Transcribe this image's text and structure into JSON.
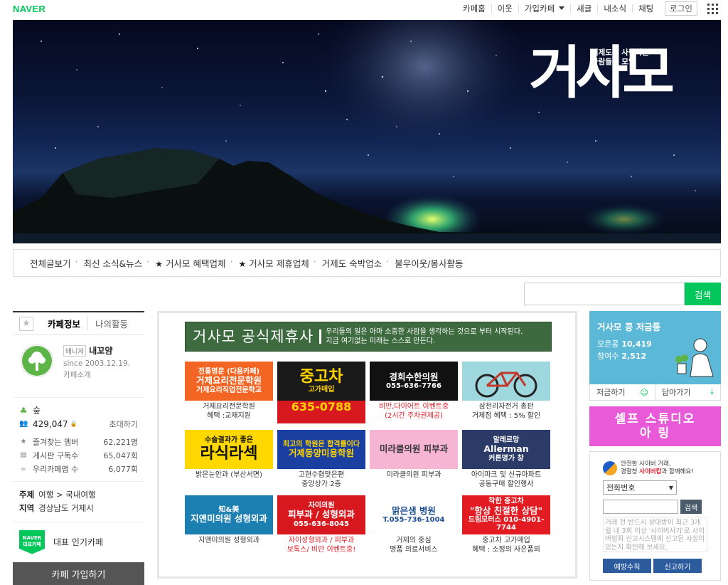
{
  "gnb": {
    "logo": "NAVER",
    "items": [
      "카페홈",
      "이웃",
      "가입카페",
      "새글",
      "내소식",
      "채팅"
    ],
    "login": "로그인"
  },
  "banner": {
    "title": "거사모",
    "subtitle_line1": "거제도를 사랑하는",
    "subtitle_line2": "사람들의 모임"
  },
  "menu": [
    {
      "label": "전체글보기",
      "star": false
    },
    {
      "label": "최신 소식&뉴스",
      "star": false
    },
    {
      "label": "거사모 혜택업체",
      "star": true
    },
    {
      "label": "거사모 제휴업체",
      "star": true
    },
    {
      "label": "거제도 숙박업소",
      "star": false
    },
    {
      "label": "불우이웃/봉사활동",
      "star": false
    }
  ],
  "search": {
    "button": "검색"
  },
  "left": {
    "tab_info": "카페정보",
    "tab_my": "나의활동",
    "manager_badge": "매니저",
    "manager_name": "내꼬얌",
    "since": "since 2003.12.19.",
    "intro": "카페소개",
    "level": "숲",
    "members": "429,047",
    "invite": "초대하기",
    "stats": [
      {
        "label": "즐겨찾는 멤버",
        "value": "62,221명"
      },
      {
        "label": "게시판 구독수",
        "value": "65,047회"
      },
      {
        "label": "우리카페앱 수",
        "value": "6,077회"
      }
    ],
    "topic_key": "주제",
    "topic_val": "여행 > 국내여행",
    "region_key": "지역",
    "region_val": "경상남도 거제시",
    "badge_line1": "NAVER",
    "badge_line2": "대표카페",
    "badge_text": "대표 인기카페",
    "join": "카페 가입하기"
  },
  "partners": {
    "title": "거사모 공식제휴사",
    "desc_line1": "우리들의 일은 아마 소중한 사람을 생각하는 것으로 부터 시작된다.",
    "desc_line2": "지금 여기없는 미래는 스스로 만든다.",
    "ads": [
      {
        "top1": "전통명문 (다음카페)",
        "top2": "거제요리전문학원",
        "top3": "거제요리직업전문학교",
        "bottom1": "거제요리전문학원",
        "bottom2": "혜택 :교재지원",
        "bg": "#f26522",
        "fg": "#ffffff"
      },
      {
        "top1": "",
        "top2": "중고차",
        "top3": "고가매입",
        "bottom1": "635-0788",
        "bottom2": "",
        "bg": "#1a1a1a",
        "fg": "#ffd400"
      },
      {
        "top1": "",
        "top2": "경희수한의원",
        "top3": "055-636-7766",
        "bottom1": "비만,다이어트 이벤트중",
        "bottom2": "(2시간 주차권제공)",
        "bg": "#111111",
        "fg": "#ffffff"
      },
      {
        "top1": "",
        "top2": "",
        "top3": "",
        "bottom1": "삼천리자전거 총판",
        "bottom2": "거제점 혜택 : 5% 할인",
        "bg": "#9fd7df",
        "fg": "#333333"
      },
      {
        "top1": "수술결과가 좋은",
        "top2": "라식라섹",
        "top3": "",
        "bottom1": "밝은눈안과 (부산서면)",
        "bottom2": "",
        "bg": "#ffd800",
        "fg": "#111111"
      },
      {
        "top1": "최고의 학원은 합격률이다",
        "top2": "거제동양미용학원",
        "top3": "",
        "bottom1": "고현수협맞은편",
        "bottom2": "중앙상가 2층",
        "bg": "#1b3fa0",
        "fg": "#ffd400"
      },
      {
        "top1": "",
        "top2": "미라클의원 피부과",
        "top3": "",
        "bottom1": "미라클의원 피부과",
        "bottom2": "",
        "bg": "#f6b5d3",
        "fg": "#333333"
      },
      {
        "top1": "알레르망",
        "top2": "Allerman",
        "top3": "커튼명가 창",
        "bottom1": "아이파크 및 신규아파트",
        "bottom2": "공동구매 할인행사",
        "bg": "#2b3a67",
        "fg": "#ffffff"
      },
      {
        "top1": "知&美",
        "top2": "지앤미의원 성형외과",
        "top3": "",
        "bottom1": "지앤미의원 성형외과",
        "bottom2": "",
        "bg": "#1c7fb1",
        "fg": "#ffffff"
      },
      {
        "top1": "자이의원",
        "top2": "피부과 / 성형외과",
        "top3": "055-636-8045",
        "bottom1": "자이성형외과 / 피부과",
        "bottom2": "보톡스/ 비만 이벤트중!",
        "bg": "#d7191f",
        "fg": "#ffffff"
      },
      {
        "top1": "",
        "top2": "맑은샘 병원",
        "top3": "T.055-736-1004",
        "bottom1": "거제의 중심",
        "bottom2": "명품 의료서비스",
        "bg": "#ffffff",
        "fg": "#1d4f91"
      },
      {
        "top1": "착한 중고차",
        "top2": "\"항상 친절한 상담\"",
        "top3": "드림모터스 010-4901-7744",
        "bottom1": "중고차 고가매입",
        "bottom2": "혜택 : 소정의 사은품외",
        "bg": "#e31b23",
        "fg": "#ffffff"
      }
    ]
  },
  "right": {
    "fund_title": "거사모 콩 저금통",
    "fund_label1": "모은콩",
    "fund_val1": "10,419",
    "fund_label2": "참여수",
    "fund_val2": "2,512",
    "fund_btn1": "저금하기",
    "fund_btn2": "담아가기",
    "studio_line1": "셀프 스튜디오",
    "studio_line2": "아 링",
    "cyber_head1": "안전한 사이버 거래,",
    "cyber_head2a": "경찰청 ",
    "cyber_head2b": "사이버캅",
    "cyber_head2c": "과 함께해요!",
    "cyber_select": "전화번호",
    "cyber_btn": "검색",
    "cyber_note": "거래 전 반드시 상대방이 최근 3개월 내 3회 이상 '사이버사기'로 사이버범죄 신고시스템에 신고된 사실이 있는지 확인해 보세요.",
    "cyber_b1": "예방수칙",
    "cyber_b2": "신고하기"
  }
}
